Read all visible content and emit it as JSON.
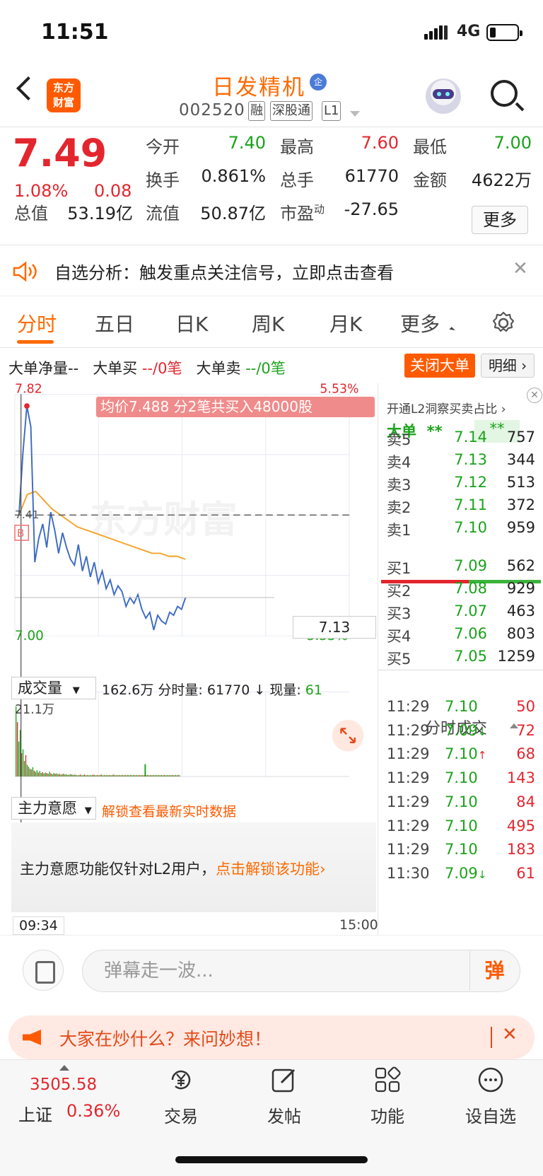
{
  "status_bar": {
    "time": "11:51",
    "network": "4G"
  },
  "header": {
    "logo_text_1": "东方",
    "logo_text_2": "财富",
    "stock_name": "日发精机",
    "badge": "企",
    "stock_code": "002520",
    "tags": [
      "融",
      "深股通",
      "L1"
    ]
  },
  "quote": {
    "price": "7.49",
    "change_pct": "1.08%",
    "change": "0.08",
    "fields": [
      {
        "label": "今开",
        "value": "7.40",
        "color": "green"
      },
      {
        "label": "最高",
        "value": "7.60",
        "color": "red"
      },
      {
        "label": "最低",
        "value": "7.00",
        "color": "green"
      },
      {
        "label": "换手",
        "value": "0.861%",
        "color": "black"
      },
      {
        "label": "总手",
        "value": "61770",
        "color": "black"
      },
      {
        "label": "金额",
        "value": "4622万",
        "color": "black"
      },
      {
        "label": "总值",
        "value": "53.19亿",
        "color": "black"
      },
      {
        "label": "流值",
        "value": "50.87亿",
        "color": "black"
      },
      {
        "label": "市盈",
        "sup": "动",
        "value": "-27.65",
        "color": "black"
      }
    ],
    "more_label": "更多"
  },
  "alert": {
    "text": "自选分析：触发重点关注信号，立即点击查看",
    "close": "✕"
  },
  "tabs": [
    {
      "label": "分时",
      "active": true
    },
    {
      "label": "五日",
      "active": false
    },
    {
      "label": "日K",
      "active": false
    },
    {
      "label": "周K",
      "active": false
    },
    {
      "label": "月K",
      "active": false
    },
    {
      "label": "更多",
      "active": false
    }
  ],
  "big_order": {
    "net_label": "大单净量--",
    "buy_label": "大单买",
    "buy_value": "--/0笔",
    "sell_label": "大单卖",
    "sell_value": "--/0笔",
    "close_button": "关闭大单",
    "detail_button": "明细"
  },
  "chart": {
    "watermark": "东方财富",
    "y_top": "7.82",
    "y_top_pct": "5.53%",
    "y_bottom": "7.00",
    "y_bottom_pct": "-5.53%",
    "prev_close_label": "7.41",
    "avg_tip": "均价7.488  分2笔共买入48000股",
    "last_price_tag": "7.13",
    "buy_marker": "B",
    "volume_select": "成交量",
    "volume_info_1": "162.6万 分时量: 61770",
    "volume_info_arrow": "↓",
    "volume_info_2": " 现量: ",
    "volume_now": "61",
    "volume_max": "21.1万",
    "intent_select": "主力意愿",
    "intent_unlock": "解锁查看最新实时数据",
    "intent_msg": "主力意愿功能仅针对L2用户，",
    "intent_link": "点击解锁该功能",
    "time_start": "09:34",
    "time_end": "15:00"
  },
  "chart_data": {
    "type": "line",
    "title": "",
    "y_range": [
      7.0,
      7.82
    ],
    "prev_close": 7.41,
    "series": [
      {
        "values": [
          7.41,
          7.62,
          7.78,
          7.71,
          7.25,
          7.33,
          7.38,
          7.3,
          7.42,
          7.36,
          7.28,
          7.35,
          7.3,
          7.26,
          7.24,
          7.31,
          7.22,
          7.27,
          7.2,
          7.25,
          7.18,
          7.22,
          7.16,
          7.19,
          7.14,
          7.17,
          7.15,
          7.1,
          7.13,
          7.11,
          7.14,
          7.09,
          7.06,
          7.08,
          7.02,
          7.07,
          7.05,
          7.04,
          7.08,
          7.07,
          7.1,
          7.09,
          7.13
        ]
      },
      {
        "values": [
          7.41,
          7.48,
          7.49,
          7.46,
          7.43,
          7.41,
          7.39,
          7.37,
          7.36,
          7.35,
          7.34,
          7.33,
          7.32,
          7.31,
          7.3,
          7.29,
          7.28,
          7.28,
          7.27,
          7.27,
          7.26
        ]
      }
    ],
    "volume_ylim": [
      0,
      211000
    ]
  },
  "order_book": {
    "promo": "开通L2洞察买卖占比",
    "big_label": "大单",
    "big_value_a": "**",
    "big_value_b": "**",
    "asks": [
      {
        "label": "卖5",
        "price": "7.14",
        "volume": "757"
      },
      {
        "label": "卖4",
        "price": "7.13",
        "volume": "344"
      },
      {
        "label": "卖3",
        "price": "7.12",
        "volume": "513"
      },
      {
        "label": "卖2",
        "price": "7.11",
        "volume": "372"
      },
      {
        "label": "卖1",
        "price": "7.10",
        "volume": "959"
      }
    ],
    "bids": [
      {
        "label": "买1",
        "price": "7.09",
        "volume": "562"
      },
      {
        "label": "买2",
        "price": "7.08",
        "volume": "929"
      },
      {
        "label": "买3",
        "price": "7.07",
        "volume": "463"
      },
      {
        "label": "买4",
        "price": "7.06",
        "volume": "803"
      },
      {
        "label": "买5",
        "price": "7.05",
        "volume": "1259"
      }
    ],
    "bid_share": 0.55
  },
  "trades": {
    "title": "分时成交",
    "rows": [
      {
        "time": "11:29",
        "price": "7.10",
        "arrow": "",
        "volume": "50"
      },
      {
        "time": "11:29",
        "price": "7.09",
        "arrow": "↓",
        "volume": "72"
      },
      {
        "time": "11:29",
        "price": "7.10",
        "arrow": "↑",
        "volume": "68"
      },
      {
        "time": "11:29",
        "price": "7.10",
        "arrow": "",
        "volume": "143"
      },
      {
        "time": "11:29",
        "price": "7.10",
        "arrow": "",
        "volume": "84"
      },
      {
        "time": "11:29",
        "price": "7.10",
        "arrow": "",
        "volume": "495"
      },
      {
        "time": "11:29",
        "price": "7.10",
        "arrow": "",
        "volume": "183"
      },
      {
        "time": "11:30",
        "price": "7.09",
        "arrow": "↓",
        "volume": "61"
      }
    ]
  },
  "comment": {
    "placeholder": "弹幕走一波...",
    "danmu_button": "弹"
  },
  "ask_banner": {
    "text": "大家在炒什么？来问妙想！",
    "close": "✕"
  },
  "bottom_nav": {
    "index_value": "3505.58",
    "index_name": "上证",
    "index_pct": "0.36%",
    "items": [
      {
        "label": "交易",
        "icon": "yen-exchange-icon"
      },
      {
        "label": "发帖",
        "icon": "edit-icon"
      },
      {
        "label": "功能",
        "icon": "grid-icon"
      },
      {
        "label": "设自选",
        "icon": "more-dots-icon"
      }
    ]
  }
}
